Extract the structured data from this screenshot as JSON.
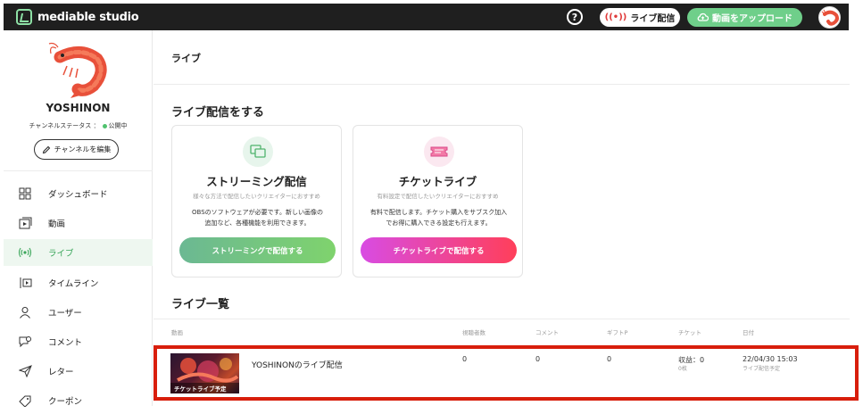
{
  "brand": {
    "name": "mediable studio"
  },
  "topbar": {
    "help_icon": "?",
    "live_label": "ライブ配信",
    "upload_label": "動画をアップロード",
    "accent_color": "#6fcf8a"
  },
  "sidebar": {
    "channel_name": "YOSHINON",
    "status_label": "チャンネルステータス ：",
    "status_value": "公開中",
    "edit_label": "チャンネルを編集",
    "items": [
      {
        "label": "ダッシュボード",
        "icon": "grid-icon"
      },
      {
        "label": "動画",
        "icon": "video-icon"
      },
      {
        "label": "ライブ",
        "icon": "broadcast-icon",
        "active": true
      },
      {
        "label": "タイムライン",
        "icon": "timeline-icon"
      },
      {
        "label": "ユーザー",
        "icon": "user-icon"
      },
      {
        "label": "コメント",
        "icon": "comment-icon"
      },
      {
        "label": "レター",
        "icon": "send-icon"
      },
      {
        "label": "クーポン",
        "icon": "coupon-icon"
      }
    ]
  },
  "main": {
    "page_title": "ライブ",
    "start_section_title": "ライブ配信をする",
    "cards": [
      {
        "title": "ストリーミング配信",
        "subtitle": "様々な方法で配信したいクリエイターにおすすめ",
        "desc_line1": "OBSのソフトウェアが必要です。新しい画像の",
        "desc_line2": "追加など、各種機能を利用できます。",
        "button": "ストリーミングで配信する"
      },
      {
        "title": "チケットライブ",
        "subtitle": "有料設定で配信したいクリエイターにおすすめ",
        "desc_line1": "有料で配信します。チケット購入をサブスク加入",
        "desc_line2": "でお得に購入できる設定も行えます。",
        "button": "チケットライブで配信する"
      }
    ],
    "list_section_title": "ライブ一覧",
    "columns": [
      "動画",
      "視聴者数",
      "コメント",
      "ギフトP",
      "チケット",
      "日付"
    ],
    "rows": [
      {
        "thumb_label": "チケットライブ予定",
        "title": "YOSHINONのライブ配信",
        "viewers": "0",
        "comments": "0",
        "gift_points": "0",
        "ticket_revenue": "収益：0",
        "ticket_sub": "0枚",
        "date": "22/04/30 15:03",
        "date_sub": "ライブ配信予定"
      }
    ]
  }
}
